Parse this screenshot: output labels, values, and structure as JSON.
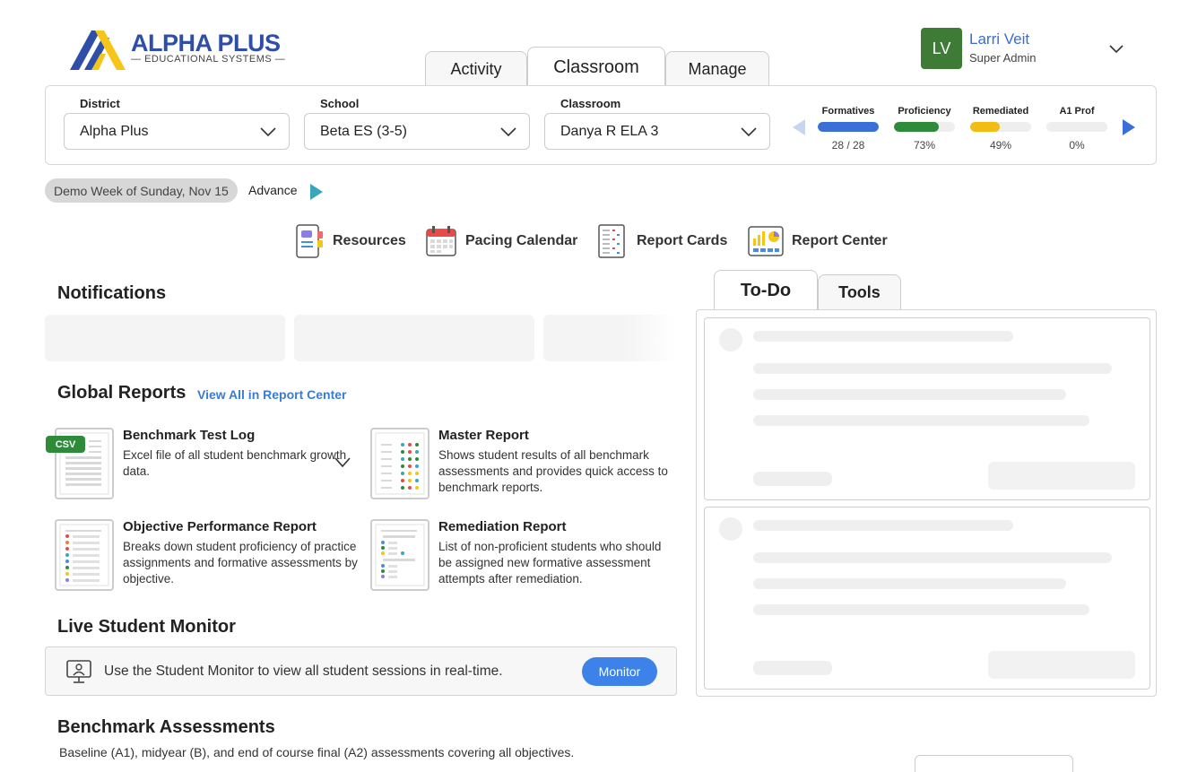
{
  "brand": {
    "name": "ALPHA PLUS",
    "subtitle": "EDUCATIONAL SYSTEMS",
    "colors": {
      "blue": "#2f4ea8",
      "yellow": "#f5c518"
    }
  },
  "top_tabs": [
    {
      "label": "Activity",
      "active": false
    },
    {
      "label": "Classroom",
      "active": true
    },
    {
      "label": "Manage",
      "active": false
    }
  ],
  "user": {
    "initials": "LV",
    "name": "Larri Veit",
    "role": "Super Admin",
    "avatar_color": "#3e7b37"
  },
  "filters": {
    "district": {
      "label": "District",
      "value": "Alpha Plus"
    },
    "school": {
      "label": "School",
      "value": "Beta ES (3-5)"
    },
    "classroom": {
      "label": "Classroom",
      "value": "Danya R ELA 3"
    }
  },
  "stats": [
    {
      "label": "Formatives",
      "value": "28 / 28",
      "fraction": 1.0,
      "color": "#3b6fd8"
    },
    {
      "label": "Proficiency",
      "value": "73%",
      "fraction": 0.73,
      "color": "#2e8b3a"
    },
    {
      "label": "Remediated",
      "value": "49%",
      "fraction": 0.49,
      "color": "#f1bd13"
    },
    {
      "label": "A1 Prof",
      "value": "0%",
      "fraction": 0.0,
      "color": "#3b6fd8"
    }
  ],
  "demo": {
    "week_label": "Demo Week of Sunday, Nov 15",
    "advance_label": "Advance"
  },
  "quick_links": [
    {
      "label": "Resources",
      "icon": "resources-icon"
    },
    {
      "label": "Pacing Calendar",
      "icon": "calendar-icon"
    },
    {
      "label": "Report Cards",
      "icon": "report-card-icon"
    },
    {
      "label": "Report Center",
      "icon": "report-center-icon"
    }
  ],
  "notifications": {
    "title": "Notifications"
  },
  "global_reports": {
    "title": "Global Reports",
    "link": "View All in Report Center",
    "items": [
      {
        "title": "Benchmark Test Log",
        "desc": "Excel file of all student benchmark growth data.",
        "badge": "CSV"
      },
      {
        "title": "Master Report",
        "desc": "Shows student results of all benchmark assessments and provides quick access to benchmark reports."
      },
      {
        "title": "Objective Performance Report",
        "desc": "Breaks down student proficiency of practice assignments and formative assessments by objective."
      },
      {
        "title": "Remediation Report",
        "desc": "List of non-proficient students who should be assigned new formative assessment attempts after remediation."
      }
    ]
  },
  "live_monitor": {
    "title": "Live Student Monitor",
    "text": "Use the Student Monitor to view all student sessions in real-time.",
    "button": "Monitor"
  },
  "benchmark": {
    "title": "Benchmark Assessments",
    "desc": "Baseline (A1), midyear (B), and end of course final (A2) assessments covering all objectives."
  },
  "right_tabs": [
    {
      "label": "To-Do",
      "active": true
    },
    {
      "label": "Tools",
      "active": false
    }
  ]
}
